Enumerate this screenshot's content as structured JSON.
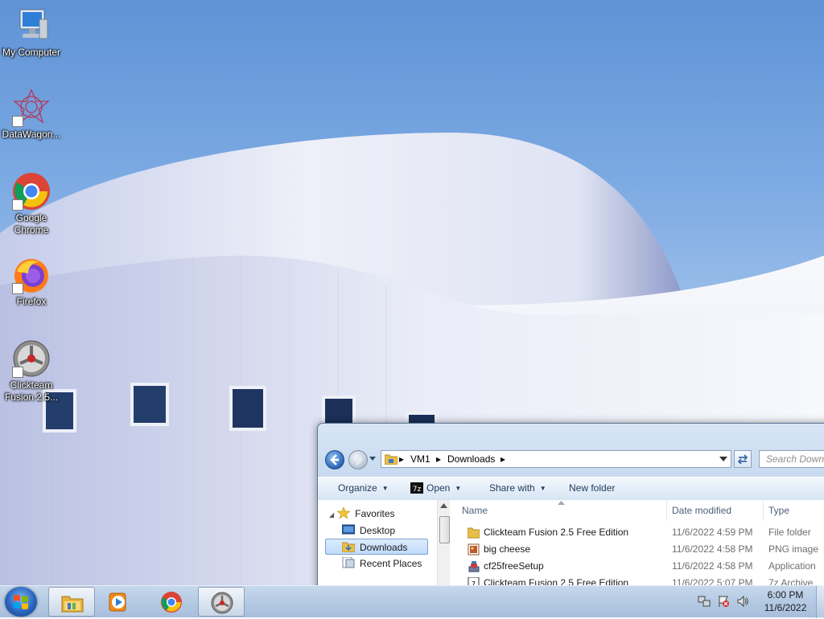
{
  "desktop": {
    "icons": [
      {
        "label": "My Computer"
      },
      {
        "label": "DataWagon..."
      },
      {
        "label": "Google Chrome"
      },
      {
        "label": "Firefox"
      },
      {
        "label": "Clickteam Fusion 2.5..."
      }
    ]
  },
  "explorer": {
    "address": {
      "crumbs": [
        "VM1",
        "Downloads"
      ]
    },
    "search_placeholder": "Search Downloads",
    "toolbar": {
      "organize": "Organize",
      "open": "Open",
      "share_with": "Share with",
      "new_folder": "New folder"
    },
    "navpane": {
      "favorites": "Favorites",
      "items": [
        "Desktop",
        "Downloads",
        "Recent Places"
      ],
      "selected": "Downloads"
    },
    "columns": {
      "name": "Name",
      "date_modified": "Date modified",
      "type": "Type"
    },
    "files": [
      {
        "name": "Clickteam Fusion 2.5 Free Edition",
        "date": "11/6/2022 4:59 PM",
        "type": "File folder",
        "icon": "folder-icon"
      },
      {
        "name": "big cheese",
        "date": "11/6/2022 4:58 PM",
        "type": "PNG image",
        "icon": "image-file-icon"
      },
      {
        "name": "cf25freeSetup",
        "date": "11/6/2022 4:58 PM",
        "type": "Application",
        "icon": "installer-icon"
      },
      {
        "name": "Clickteam Fusion 2.5 Free Edition",
        "date": "11/6/2022 5:07 PM",
        "type": "7z Archive",
        "icon": "archive-icon"
      }
    ]
  },
  "taskbar": {
    "apps": [
      {
        "name": "Windows Explorer",
        "icon": "folder-library-icon",
        "active": true
      },
      {
        "name": "Windows Media Player",
        "icon": "media-player-icon",
        "active": false
      },
      {
        "name": "Google Chrome",
        "icon": "chrome-icon",
        "active": false
      },
      {
        "name": "Clickteam Fusion",
        "icon": "clickteam-icon",
        "active": true
      }
    ],
    "clock": {
      "time": "6:00 PM",
      "date": "11/6/2022"
    }
  },
  "colors": {
    "sky": "#7ba9e2",
    "building": "#e8ecf7",
    "window_frame": "#c3d7ee",
    "selection": "#c1dbfc"
  }
}
